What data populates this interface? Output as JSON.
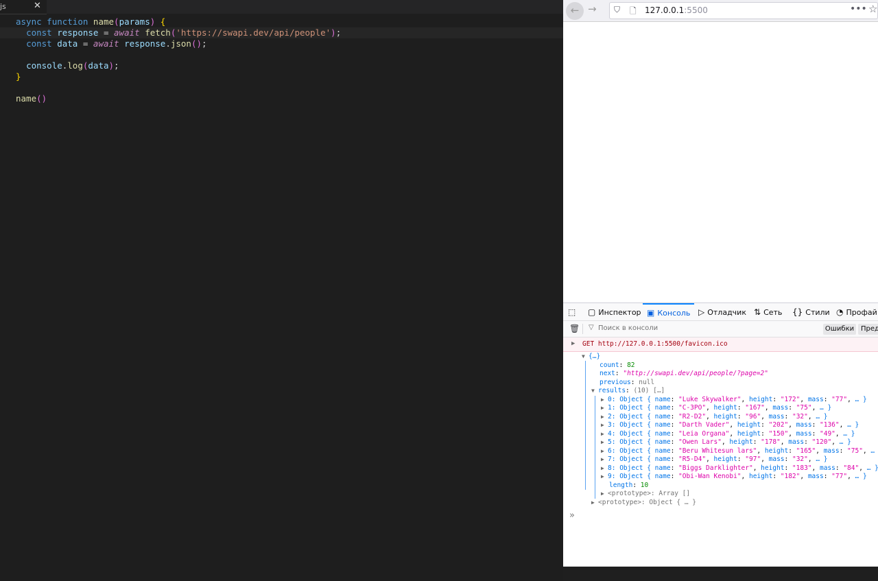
{
  "editor": {
    "tab": {
      "label": "js",
      "close": "✕"
    },
    "lines": [
      {
        "text": "async function name(params) {"
      },
      {
        "text": "  const response = await fetch('https://swapi.dev/api/people');"
      },
      {
        "text": "  const data = await response.json();"
      },
      {
        "text": ""
      },
      {
        "text": "  console.log(data);"
      },
      {
        "text": "}"
      },
      {
        "text": ""
      },
      {
        "text": "name()"
      }
    ]
  },
  "browser": {
    "url_host": "127.0.0.1",
    "url_port": ":5500",
    "more": "•••",
    "icons": {
      "back": "arrow-left-icon",
      "forward": "arrow-right-icon",
      "shield": "shield-icon",
      "page": "page-icon",
      "star": "star-icon"
    }
  },
  "devtools": {
    "tabs": [
      {
        "label": "Инспектор",
        "icon": "inspector-icon"
      },
      {
        "label": "Консоль",
        "icon": "console-icon"
      },
      {
        "label": "Отладчик",
        "icon": "debugger-icon"
      },
      {
        "label": "Сеть",
        "icon": "network-icon"
      },
      {
        "label": "Стили",
        "icon": "styles-icon"
      },
      {
        "label": "Профай",
        "icon": "profiler-icon"
      }
    ],
    "filter_placeholder": "Поиск в консоли",
    "btn_errors": "Ошибки",
    "btn_warnings": "Пред",
    "error_message": "GET http://127.0.0.1:5500/favicon.ico",
    "tree": {
      "root": "{…}",
      "count_key": "count",
      "count_val": "82",
      "next_key": "next",
      "next_val": "\"http://swapi.dev/api/people/?page=2\"",
      "previous_key": "previous",
      "previous_val": "null",
      "results_key": "results",
      "results_meta": "(10) […]",
      "items": [
        {
          "idx": "0",
          "name": "\"Luke Skywalker\"",
          "height": "\"172\"",
          "mass": "\"77\""
        },
        {
          "idx": "1",
          "name": "\"C-3PO\"",
          "height": "\"167\"",
          "mass": "\"75\""
        },
        {
          "idx": "2",
          "name": "\"R2-D2\"",
          "height": "\"96\"",
          "mass": "\"32\""
        },
        {
          "idx": "3",
          "name": "\"Darth Vader\"",
          "height": "\"202\"",
          "mass": "\"136\""
        },
        {
          "idx": "4",
          "name": "\"Leia Organa\"",
          "height": "\"150\"",
          "mass": "\"49\""
        },
        {
          "idx": "5",
          "name": "\"Owen Lars\"",
          "height": "\"178\"",
          "mass": "\"120\""
        },
        {
          "idx": "6",
          "name": "\"Beru Whitesun lars\"",
          "height": "\"165\"",
          "mass": "\"75\""
        },
        {
          "idx": "7",
          "name": "\"R5-D4\"",
          "height": "\"97\"",
          "mass": "\"32\""
        },
        {
          "idx": "8",
          "name": "\"Biggs Darklighter\"",
          "height": "\"183\"",
          "mass": "\"84\""
        },
        {
          "idx": "9",
          "name": "\"Obi-Wan Kenobi\"",
          "height": "\"182\"",
          "mass": "\"77\""
        }
      ],
      "length_key": "length",
      "length_val": "10",
      "proto_array": "<prototype>: Array []",
      "proto_object": "<prototype>: Object { … }"
    },
    "prompt": "»"
  }
}
